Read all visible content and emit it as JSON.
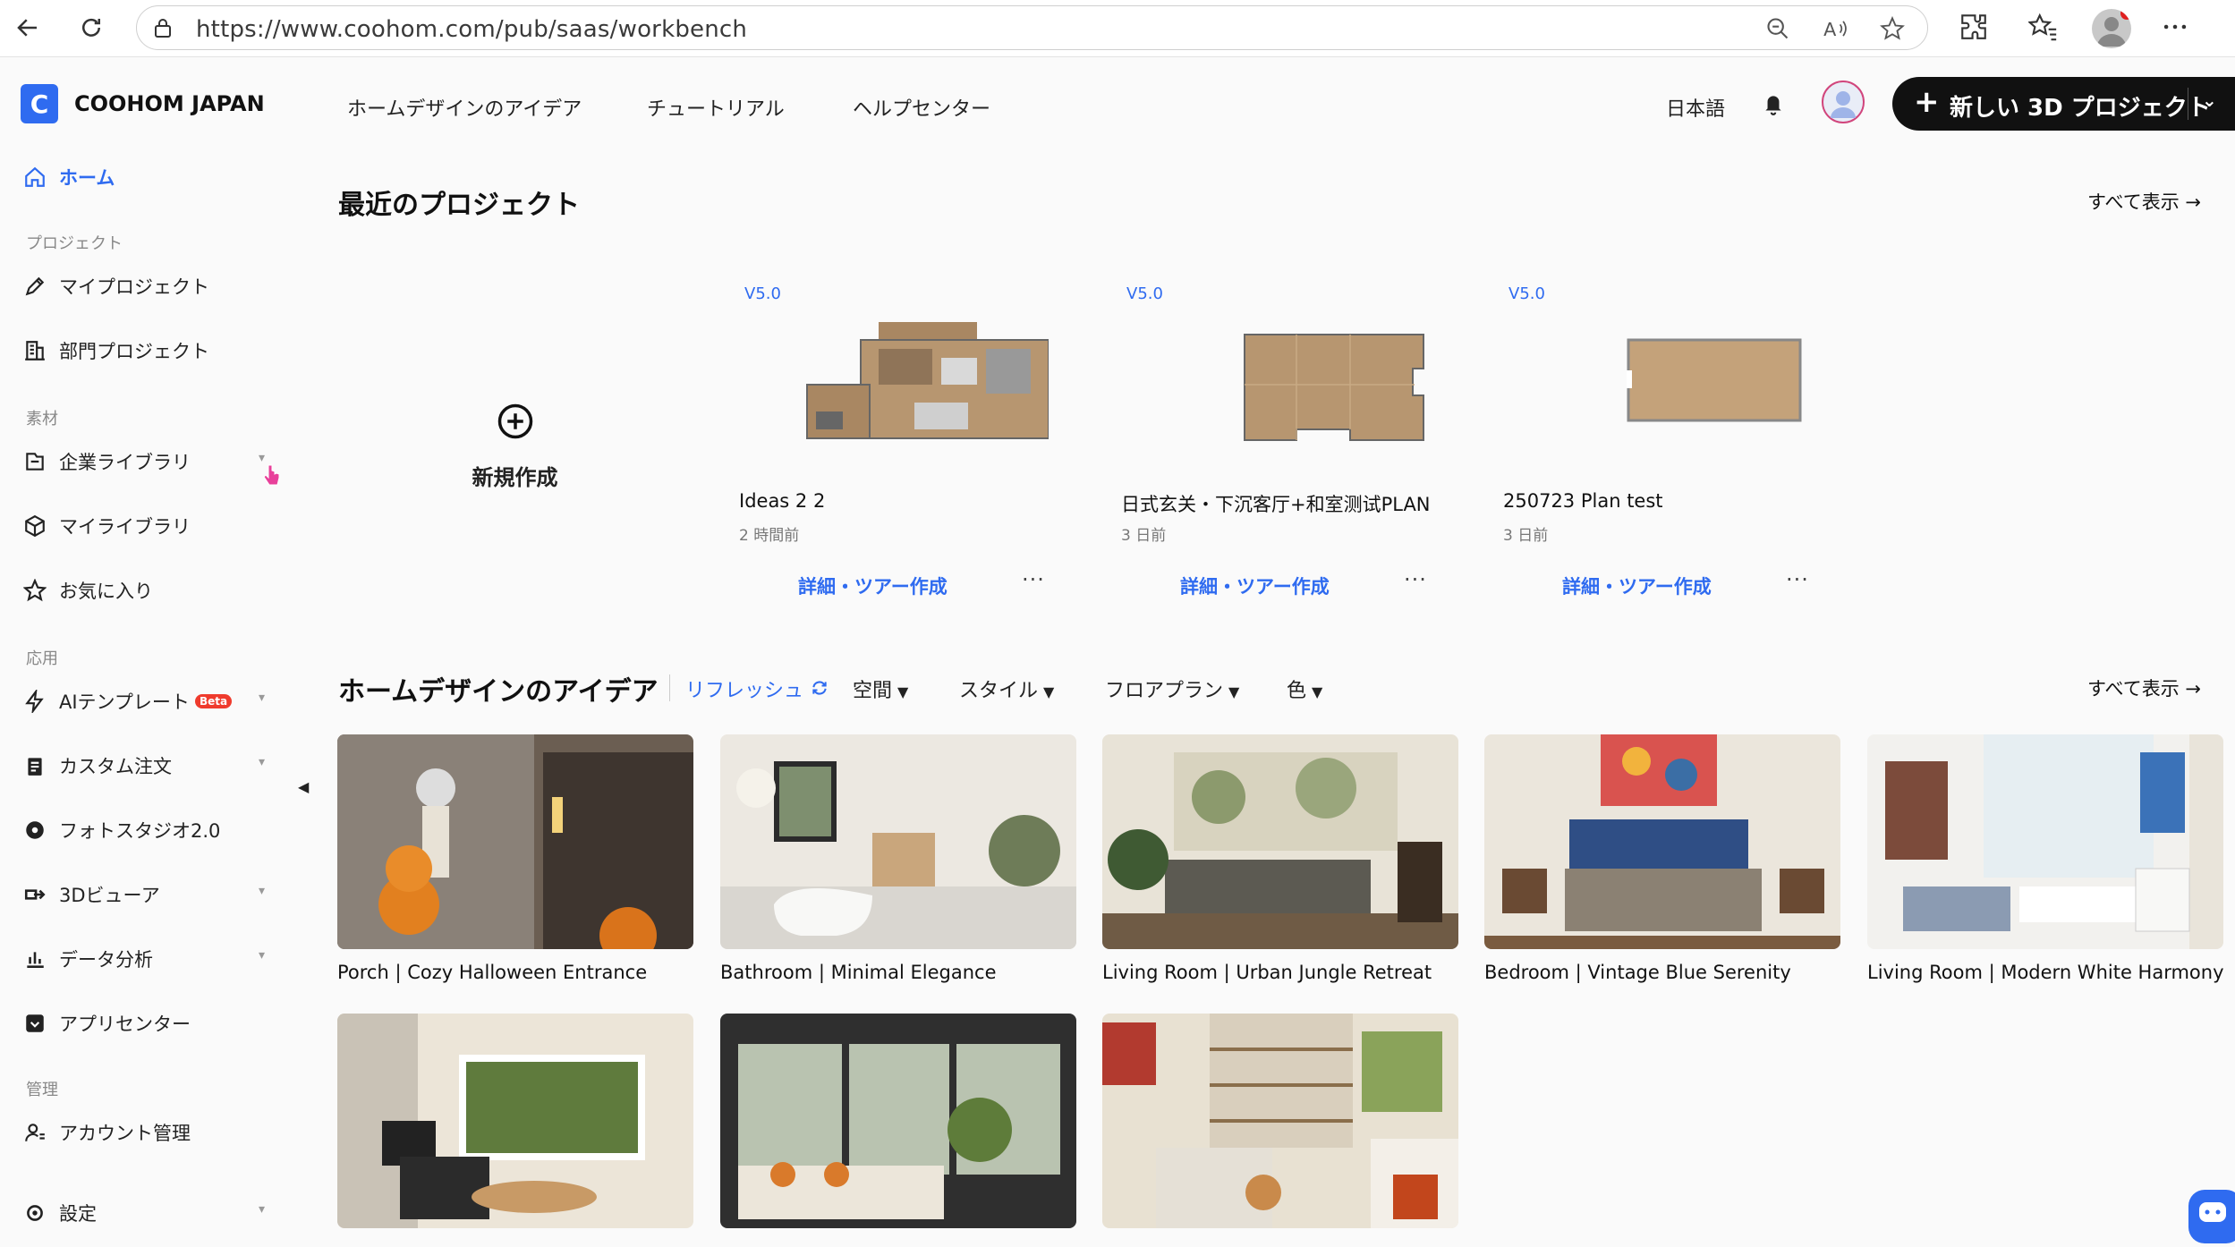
{
  "browser": {
    "url": "https://www.coohom.com/pub/saas/workbench"
  },
  "header": {
    "brand": "COOHOM JAPAN",
    "nav": [
      "ホームデザインのアイデア",
      "チュートリアル",
      "ヘルプセンター"
    ],
    "language": "日本語",
    "new_project_label": "新しい 3D プロジェクト"
  },
  "sidebar": {
    "home": "ホーム",
    "sections": {
      "project": "プロジェクト",
      "materials": "素材",
      "apps": "応用",
      "admin": "管理"
    },
    "items": {
      "my_projects": "マイプロジェクト",
      "dept_projects": "部門プロジェクト",
      "enterprise_library": "企業ライブラリ",
      "my_library": "マイライブラリ",
      "favorites": "お気に入り",
      "ai_template": "AIテンプレート",
      "ai_badge": "Beta",
      "custom_order": "カスタム注文",
      "photo_studio": "フォトスタジオ2.0",
      "viewer_3d": "3Dビューア",
      "data_analysis": "データ分析",
      "app_center": "アプリセンター",
      "account": "アカウント管理",
      "settings": "設定"
    }
  },
  "recent": {
    "title": "最近のプロジェクト",
    "see_all": "すべて表示 →",
    "new_label": "新規作成",
    "projects": [
      {
        "version": "V5.0",
        "name": "Ideas 2 2",
        "time": "2 時間前",
        "action": "詳細・ツアー作成",
        "more": "···"
      },
      {
        "version": "V5.0",
        "name": "日式玄关・下沉客厅+和室测试PLAN",
        "time": "3 日前",
        "action": "詳細・ツアー作成",
        "more": "···"
      },
      {
        "version": "V5.0",
        "name": "250723 Plan test",
        "time": "3 日前",
        "action": "詳細・ツアー作成",
        "more": "···"
      }
    ]
  },
  "ideas": {
    "title": "ホームデザインのアイデア",
    "refresh": "リフレッシュ",
    "see_all": "すべて表示 →",
    "filters": [
      "空間",
      "スタイル",
      "フロアプラン",
      "色"
    ],
    "cards": [
      {
        "caption": "Porch | Cozy Halloween Entrance"
      },
      {
        "caption": "Bathroom | Minimal Elegance"
      },
      {
        "caption": "Living Room | Urban Jungle Retreat"
      },
      {
        "caption": "Bedroom | Vintage Blue Serenity"
      },
      {
        "caption": "Living Room | Modern White Harmony"
      }
    ]
  },
  "colors": {
    "accent": "#2f6bf0",
    "dark": "#111111",
    "badge": "#ef3b2d"
  }
}
